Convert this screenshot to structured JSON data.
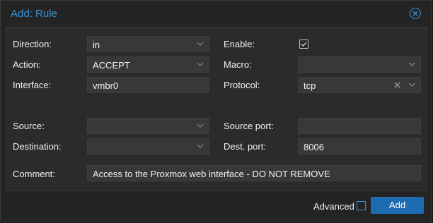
{
  "dialog": {
    "title": "Add: Rule"
  },
  "form": {
    "direction": {
      "label": "Direction:",
      "value": "in"
    },
    "action": {
      "label": "Action:",
      "value": "ACCEPT"
    },
    "interface": {
      "label": "Interface:",
      "value": "vmbr0"
    },
    "enable": {
      "label": "Enable:",
      "checked": true
    },
    "macro": {
      "label": "Macro:",
      "value": ""
    },
    "protocol": {
      "label": "Protocol:",
      "value": "tcp"
    },
    "source": {
      "label": "Source:",
      "value": ""
    },
    "source_port": {
      "label": "Source port:",
      "value": ""
    },
    "destination": {
      "label": "Destination:",
      "value": ""
    },
    "dest_port": {
      "label": "Dest. port:",
      "value": "8006"
    },
    "comment": {
      "label": "Comment:",
      "value": "Access to the Proxmox web interface - DO NOT REMOVE"
    }
  },
  "footer": {
    "advanced_label": "Advanced",
    "advanced_checked": false,
    "add_label": "Add"
  },
  "colors": {
    "accent": "#3a93d4",
    "button": "#1d6cb1",
    "field_bg": "#383838",
    "panel_bg": "#2b2b2b"
  }
}
